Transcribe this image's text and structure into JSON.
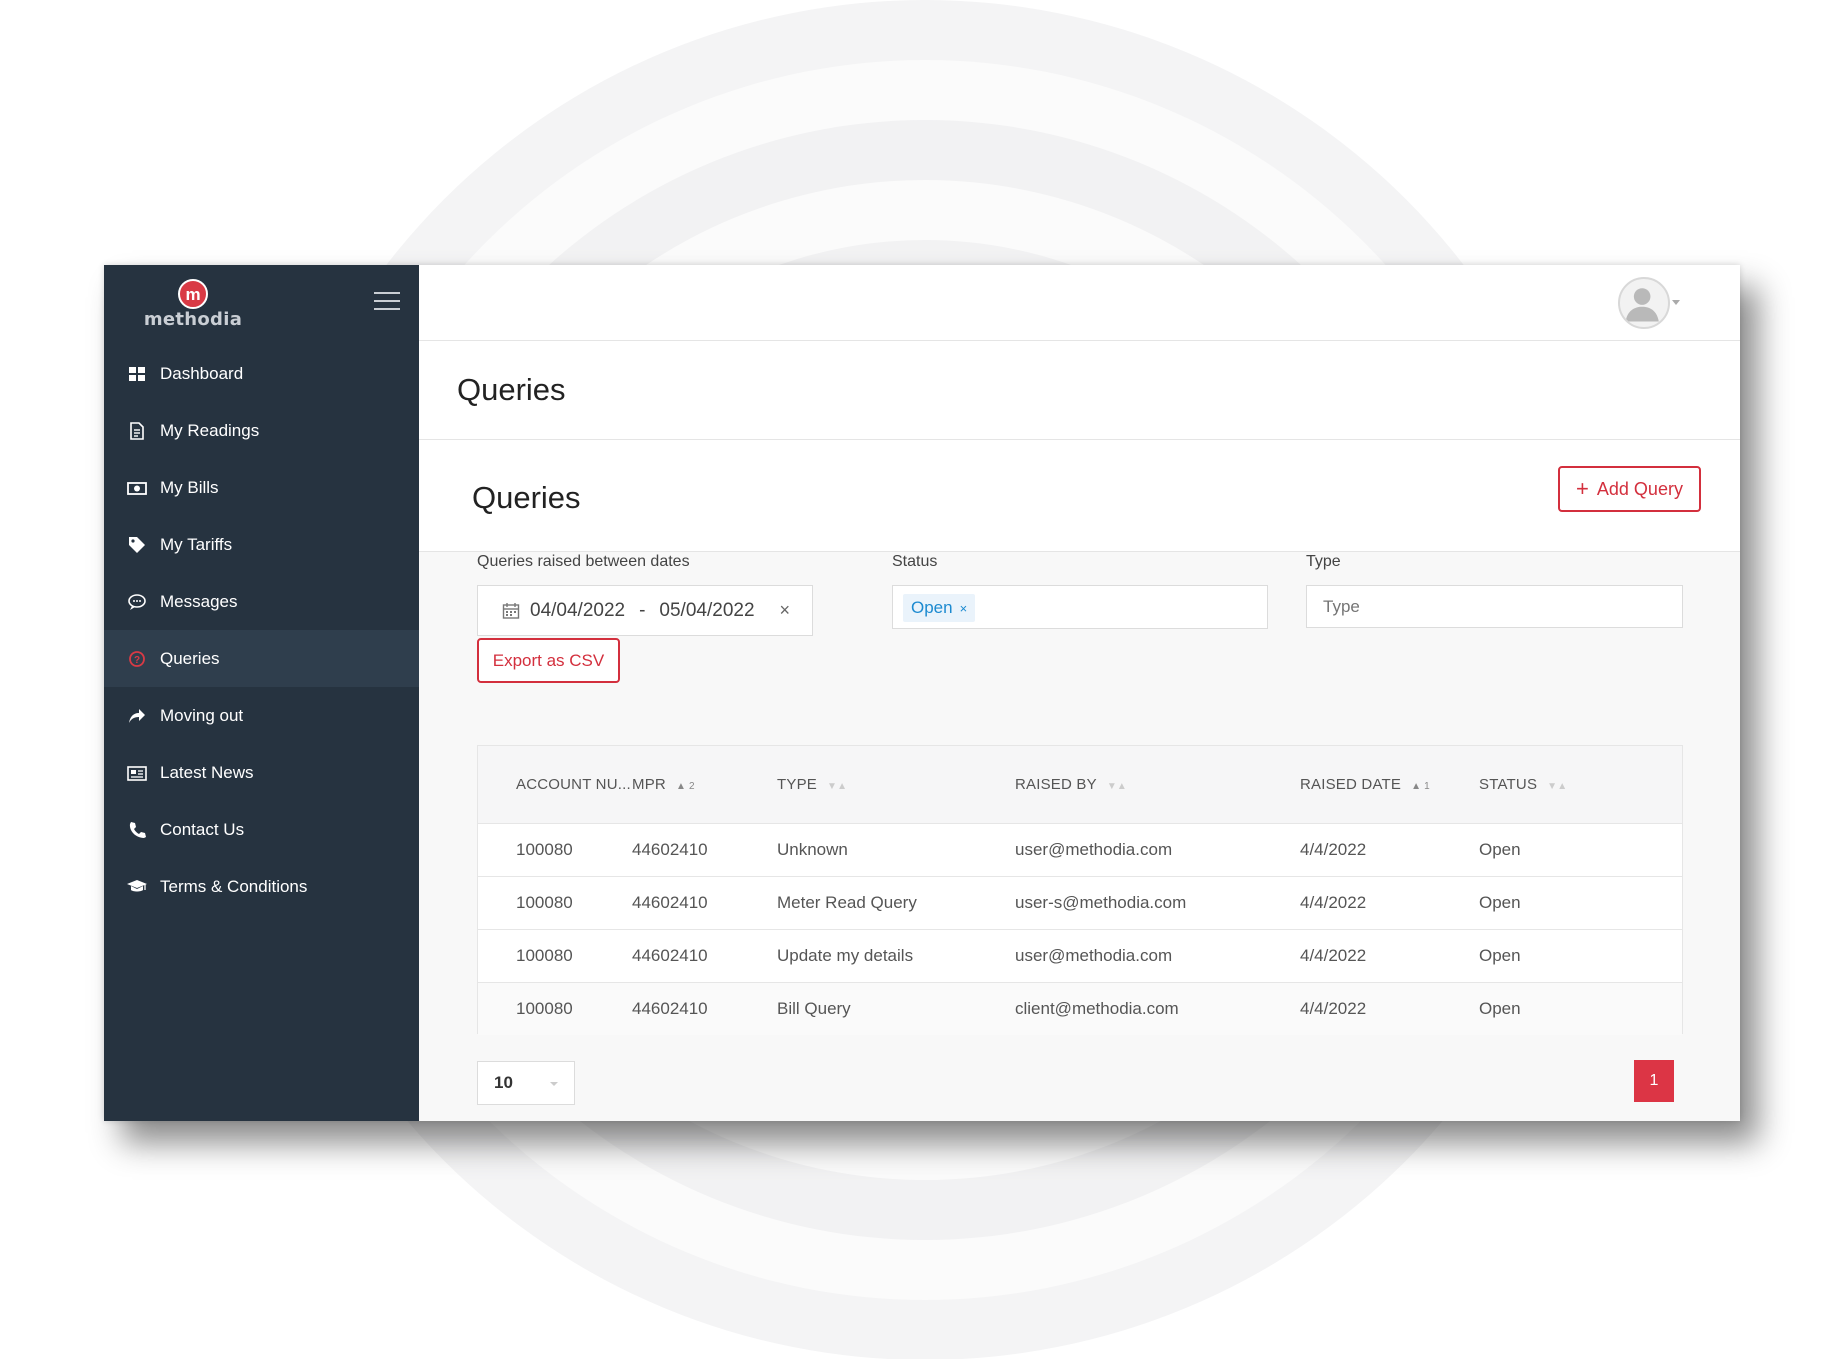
{
  "brand": {
    "logo_letter": "m",
    "logo_text": "methodia",
    "accent": "#d32f3d",
    "sidebar_bg": "#263340"
  },
  "sidebar": {
    "items": [
      {
        "label": "Dashboard",
        "icon": "dashboard-icon"
      },
      {
        "label": "My Readings",
        "icon": "document-icon"
      },
      {
        "label": "My Bills",
        "icon": "money-icon"
      },
      {
        "label": "My Tariffs",
        "icon": "tag-icon"
      },
      {
        "label": "Messages",
        "icon": "chat-icon"
      },
      {
        "label": "Queries",
        "icon": "question-icon",
        "active": true
      },
      {
        "label": "Moving out",
        "icon": "share-arrow-icon"
      },
      {
        "label": "Latest News",
        "icon": "newspaper-icon"
      },
      {
        "label": "Contact Us",
        "icon": "phone-icon"
      },
      {
        "label": "Terms & Conditions",
        "icon": "graduation-cap-icon"
      }
    ]
  },
  "page": {
    "title": "Queries"
  },
  "card": {
    "title": "Queries",
    "add_button": "Add Query",
    "add_button_plus": "+"
  },
  "filters": {
    "dates_label": "Queries raised between dates",
    "date_from": "04/04/2022",
    "date_sep": "-",
    "date_to": "05/04/2022",
    "clear": "×",
    "export_button": "Export as CSV",
    "status_label": "Status",
    "status_tag": "Open",
    "status_tag_remove": "×",
    "type_label": "Type",
    "type_placeholder": "Type"
  },
  "table": {
    "columns": [
      {
        "label": "ACCOUNT NU...",
        "sort": ""
      },
      {
        "label": "MPR",
        "sort": "▲ 2"
      },
      {
        "label": "TYPE",
        "sort": "▼▲"
      },
      {
        "label": "RAISED BY",
        "sort": "▼▲"
      },
      {
        "label": "RAISED DATE",
        "sort": "▲ 1"
      },
      {
        "label": "STATUS",
        "sort": "▼▲"
      }
    ],
    "rows": [
      [
        "100080",
        "44602410",
        "Unknown",
        "user@methodia.com",
        "4/4/2022",
        "Open"
      ],
      [
        "100080",
        "44602410",
        "Meter Read Query",
        "user-s@methodia.com",
        "4/4/2022",
        "Open"
      ],
      [
        "100080",
        "44602410",
        "Update my details",
        "user@methodia.com",
        "4/4/2022",
        "Open"
      ],
      [
        "100080",
        "44602410",
        "Bill Query",
        "client@methodia.com",
        "4/4/2022",
        "Open"
      ]
    ]
  },
  "pagination": {
    "page_size": "10",
    "current_page": "1"
  }
}
